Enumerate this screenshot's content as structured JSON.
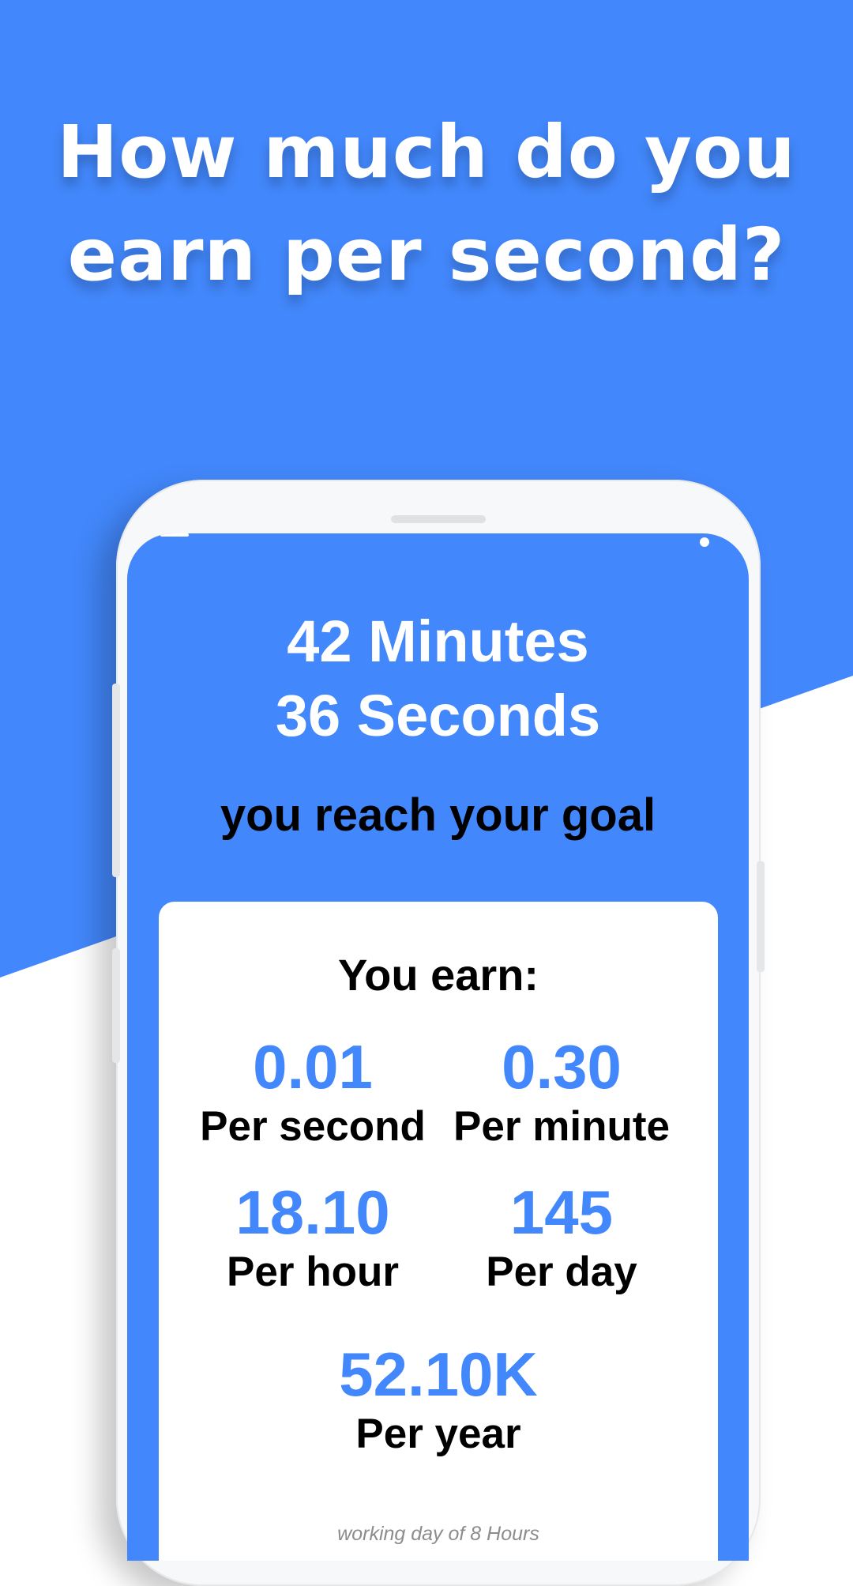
{
  "headline": {
    "line1": "How much do you",
    "line2": "earn per second?"
  },
  "colors": {
    "accent": "#4287fb",
    "background": "#ffffff",
    "text_dark": "#000000",
    "note_gray": "#8c8c8c"
  },
  "icons": {
    "menu": "menu-icon",
    "share": "share-icon"
  },
  "app": {
    "time_line1": "42 Minutes",
    "time_line2": "36 Seconds",
    "goal_text": "you reach your goal",
    "earn_title": "You earn:",
    "stats": [
      {
        "value": "0.01",
        "label": "Per second"
      },
      {
        "value": "0.30",
        "label": "Per minute"
      },
      {
        "value": "18.10",
        "label": "Per hour"
      },
      {
        "value": "145",
        "label": "Per day"
      },
      {
        "value": "52.10K",
        "label": "Per year"
      }
    ],
    "note": "working day of 8 Hours"
  }
}
